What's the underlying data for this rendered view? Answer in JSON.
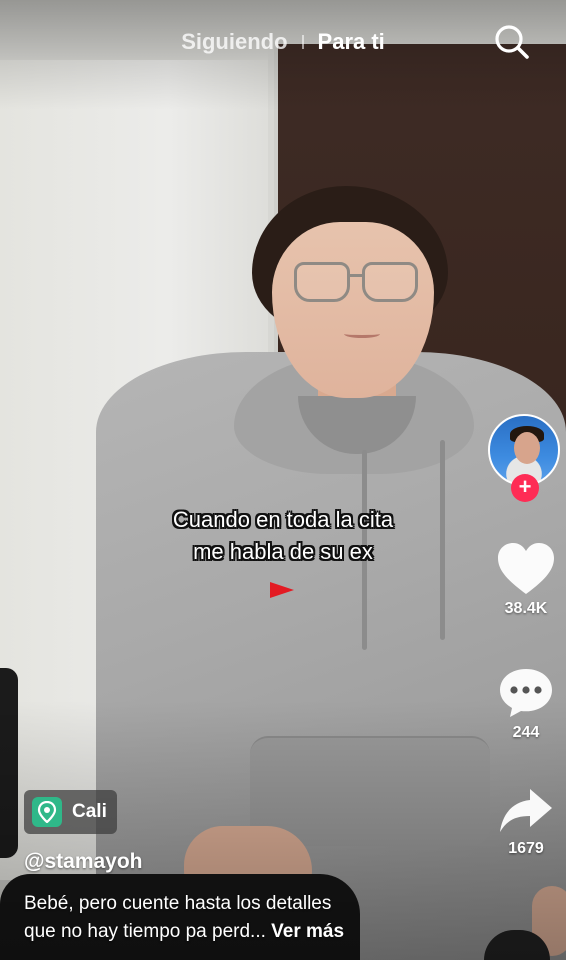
{
  "top_nav": {
    "following_label": "Siguiendo",
    "for_you_label": "Para ti",
    "active_tab": "Para ti",
    "search_icon": "search-icon"
  },
  "video": {
    "caption_lines": [
      "Cuando en toda la cita",
      "me habla de su ex"
    ],
    "flag_icon": "red-flag-icon",
    "flag_color": "#e31b23"
  },
  "actions": {
    "avatar_icon": "profile-avatar",
    "follow_icon": "plus-icon",
    "follow_glyph": "+",
    "like_icon": "heart-icon",
    "like_count": "38.4K",
    "comment_icon": "comment-bubble-icon",
    "comment_count": "244",
    "share_icon": "share-arrow-icon",
    "share_count": "1679",
    "accent_color": "#fe2c55"
  },
  "meta": {
    "location_icon": "location-pin-icon",
    "location_label": "Cali",
    "location_color": "#2fb889",
    "username": "@stamayoh",
    "description_line1": "Bebé, pero cuente hasta los detalles",
    "description_line2": "que no hay tiempo pa perd...",
    "see_more_label": "Ver más"
  }
}
